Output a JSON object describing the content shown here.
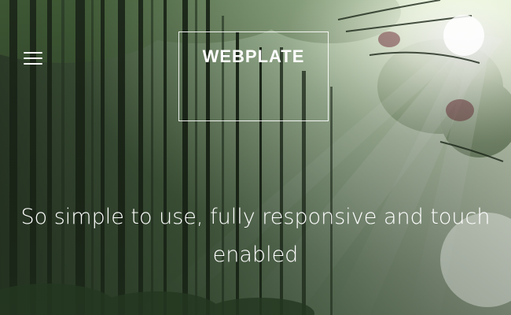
{
  "header": {
    "menu_icon": "hamburger-menu-icon",
    "brand": "WEBPLATE"
  },
  "hero": {
    "background": "sunlit-forest-image",
    "tagline_line1": "So simple to use, fully responsive and touch",
    "tagline_line2": "enabled"
  },
  "colors": {
    "text": "#ffffff",
    "forest_dark": "#1f2e1e",
    "forest_mid": "#5b7a52",
    "light_haze": "#e8f2e0"
  }
}
